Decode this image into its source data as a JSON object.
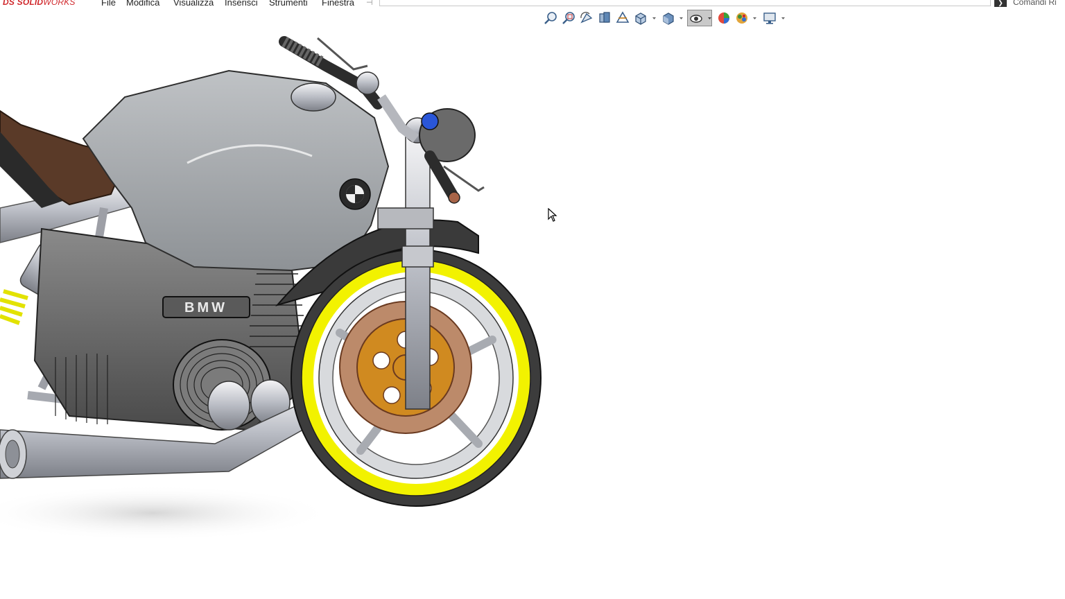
{
  "app": {
    "logo": "SOLIDWORKS",
    "logo_prefix": "DS",
    "logo_bold": "SOLID",
    "logo_light": "WORKS"
  },
  "menu": [
    {
      "label": "File"
    },
    {
      "label": "Modifica"
    },
    {
      "label": "Visualizza"
    },
    {
      "label": "Inserisci"
    },
    {
      "label": "Strumenti"
    },
    {
      "label": "Finestra"
    }
  ],
  "search": {
    "placeholder": "Comandi Ri"
  },
  "toolbar": {
    "icons": [
      "zoom-to-fit-icon",
      "zoom-to-area-icon",
      "previous-view-icon",
      "section-view-icon",
      "dynamic-annotation-icon",
      "view-orientation-icon",
      "display-style-icon",
      "hide-show-items-icon",
      "edit-appearance-icon",
      "apply-scene-icon",
      "view-settings-icon"
    ],
    "active": "hide-show-items-icon"
  },
  "model": {
    "badge_text": "BMW",
    "tank_emblem": "BMW"
  },
  "colors": {
    "tire_highlight": "#f2f200",
    "brake_hub": "#d08a20",
    "tank": "#a7aaad",
    "seat": "#5a3a28"
  }
}
